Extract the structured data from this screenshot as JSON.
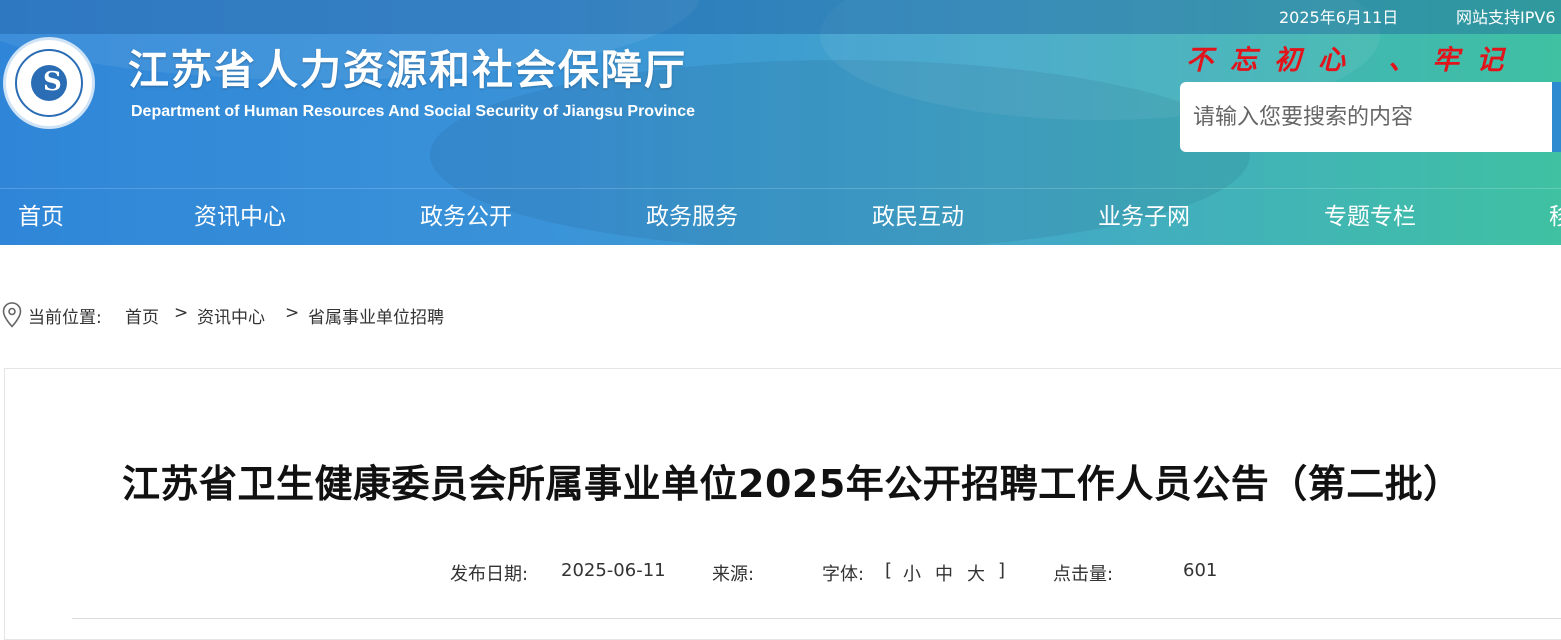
{
  "header": {
    "date": "2025年6月11日",
    "ipv6_text": "网站支持IPV6",
    "site_name_cn": "江苏省人力资源和社会保障厅",
    "site_name_en": "Department of Human Resources And Social Security of Jiangsu Province",
    "slogan": "不忘初心 、牢记",
    "search": {
      "placeholder": "请输入您要搜索的内容"
    }
  },
  "nav": {
    "items": [
      "首页",
      "资讯中心",
      "政务公开",
      "政务服务",
      "政民互动",
      "业务子网",
      "专题专栏",
      "移"
    ]
  },
  "breadcrumb": {
    "prefix": "当前位置:",
    "items": [
      "首页",
      "资讯中心",
      "省属事业单位招聘"
    ],
    "separator": ">"
  },
  "article": {
    "title": "江苏省卫生健康委员会所属事业单位2025年公开招聘工作人员公告（第二批）",
    "publish_label": "发布日期:",
    "publish_date": "2025-06-11",
    "source_label": "来源:",
    "source_value": "",
    "font_label": "字体:",
    "font_open": "[",
    "font_sizes": [
      "小",
      "中",
      "大"
    ],
    "font_close": "]",
    "clicks_label": "点击量:",
    "clicks_value": "601"
  },
  "colors": {
    "slogan_red": "#e3131b",
    "header_blue": "#2f86d8",
    "header_green": "#3fc1a2"
  },
  "icons": {
    "location": "location-pin-icon",
    "emblem": "emblem-logo"
  }
}
